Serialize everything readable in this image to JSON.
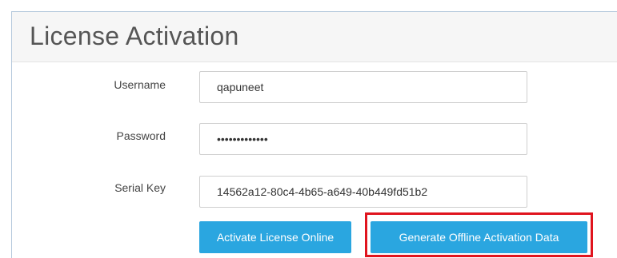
{
  "header": {
    "title": "License Activation"
  },
  "form": {
    "username": {
      "label": "Username",
      "value": "qapuneet"
    },
    "password": {
      "label": "Password",
      "value": "•••••••••••••"
    },
    "serial_key": {
      "label": "Serial Key",
      "value": "14562a12-80c4-4b65-a649-40b449fd51b2"
    }
  },
  "actions": {
    "activate_online_label": "Activate License Online",
    "generate_offline_label": "Generate Offline Activation Data"
  },
  "colors": {
    "button_bg": "#2aa6e0",
    "highlight_border": "#e0141e"
  }
}
